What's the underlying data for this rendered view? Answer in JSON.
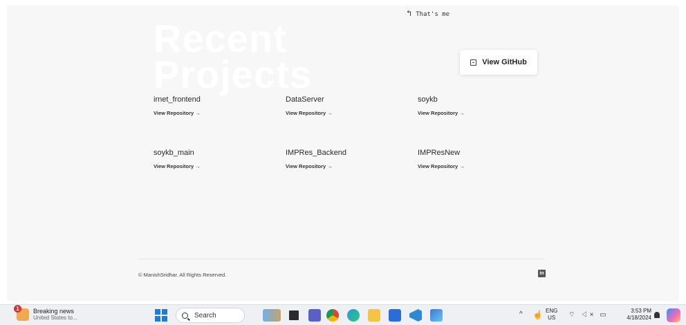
{
  "hint": {
    "arrow": "↰",
    "text": "That's me"
  },
  "hero": {
    "line1": "Recent",
    "line2": "Projects"
  },
  "github_button": {
    "label": "View GitHub"
  },
  "projects": [
    {
      "name": "irnet_frontend",
      "link": "View Repository →"
    },
    {
      "name": "DataServer",
      "link": "View Repository →"
    },
    {
      "name": "soykb",
      "link": "View Repository →"
    },
    {
      "name": "soykb_main",
      "link": "View Repository →"
    },
    {
      "name": "IMPRes_Backend",
      "link": "View Repository →"
    },
    {
      "name": "IMPResNew",
      "link": "View Repository →"
    }
  ],
  "footer": {
    "copyright": "© ManishSridhar. All Rights Reserved.",
    "social": "in"
  },
  "taskbar": {
    "news_badge": "1",
    "news_title": "Breaking news",
    "news_sub": "United States to...",
    "search_placeholder": "Search",
    "tray_chevron": "^",
    "lang_top": "ENG",
    "lang_bottom": "US",
    "sys_icons": "⌔ ◁× ▭",
    "time": "3:53 PM",
    "date": "4/18/2024"
  },
  "colors": {
    "page_bg": "#f7f7f7",
    "taskbar_bg": "#eef0f4",
    "windows_blue": "#1f7ae0"
  }
}
